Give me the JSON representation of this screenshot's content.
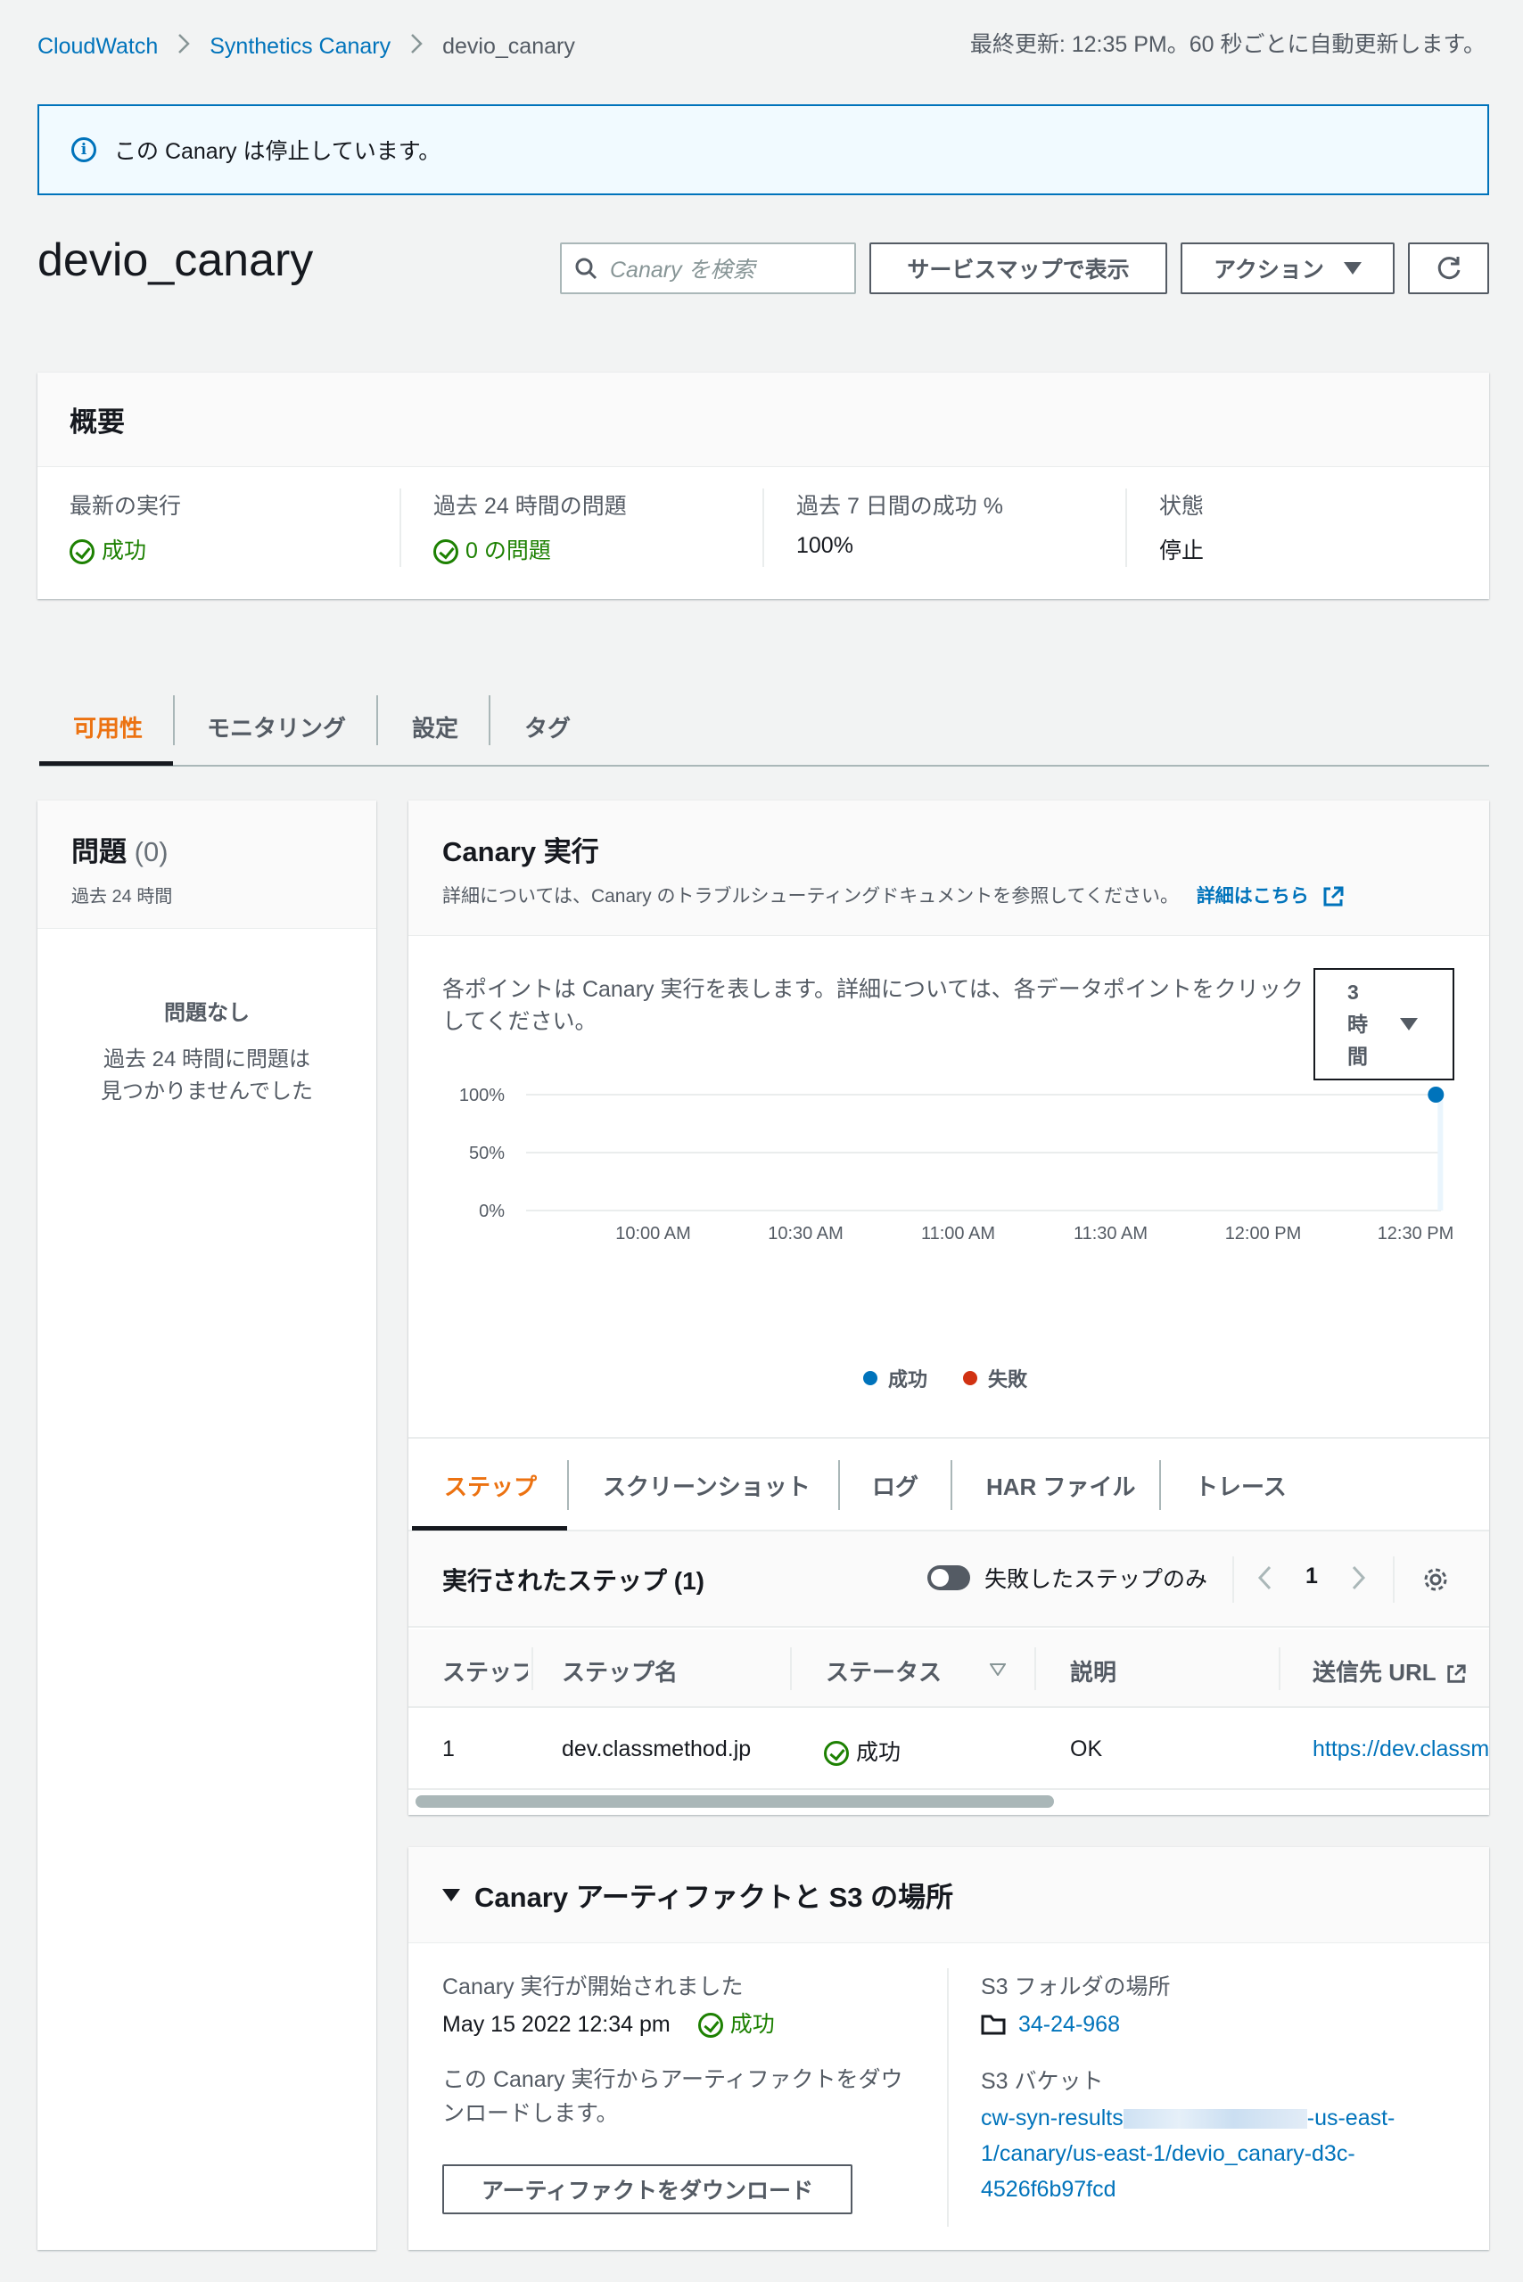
{
  "breadcrumb": {
    "item1": "CloudWatch",
    "item2": "Synthetics Canary",
    "current": "devio_canary"
  },
  "last_updated": "最終更新: 12:35 PM。60 秒ごとに自動更新します。",
  "banner": {
    "text": "この Canary は停止しています。"
  },
  "page_title": "devio_canary",
  "search": {
    "placeholder": "Canary を検索"
  },
  "header_buttons": {
    "service_map": "サービスマップで表示",
    "actions": "アクション"
  },
  "overview": {
    "title": "概要",
    "latest_run_label": "最新の実行",
    "latest_run_value": "成功",
    "issues_label": "過去 24 時間の問題",
    "issues_value": "0 の問題",
    "success_label": "過去 7 日間の成功 %",
    "success_value": "100%",
    "state_label": "状態",
    "state_value": "停止"
  },
  "tabs": [
    "可用性",
    "モニタリング",
    "設定",
    "タグ"
  ],
  "issues_panel": {
    "title": "問題",
    "count": "(0)",
    "subtitle": "過去 24 時間",
    "empty_title": "問題なし",
    "empty_line1": "過去 24 時間に問題は",
    "empty_line2": "見つかりませんでした"
  },
  "runs_panel": {
    "title": "Canary 実行",
    "description": "詳細については、Canary のトラブルシューティングドキュメントを参照してください。",
    "learn_more": "詳細はこちら",
    "hint_line1": "各ポイントは Canary 実行を表します。詳細については、各データポイントをクリック",
    "hint_line2": "してください。",
    "range_select": [
      "3",
      "時",
      "間"
    ]
  },
  "chart_data": {
    "type": "scatter",
    "x_ticks": [
      "10:00 AM",
      "10:30 AM",
      "11:00 AM",
      "11:30 AM",
      "12:00 PM",
      "12:30 PM"
    ],
    "y_ticks": [
      "100%",
      "50%",
      "0%"
    ],
    "ylim": [
      0,
      100
    ],
    "x_range_minutes": [
      "9:35 AM",
      "12:35 PM"
    ],
    "series": [
      {
        "name": "成功",
        "color": "#0073bb",
        "points": [
          {
            "x": "12:34 PM",
            "y": 100
          }
        ]
      },
      {
        "name": "失敗",
        "color": "#d13212",
        "points": []
      }
    ]
  },
  "sub_tabs": [
    "ステップ",
    "スクリーンショット",
    "ログ",
    "HAR ファイル",
    "トレース"
  ],
  "steps": {
    "title": "実行されたステップ (1)",
    "toggle_label": "失敗したステップのみ",
    "page": "1",
    "columns": [
      "ステップ",
      "ステップ名",
      "ステータス",
      "説明",
      "送信先 URL"
    ],
    "rows": [
      {
        "step": "1",
        "name": "dev.classmethod.jp",
        "status": "成功",
        "description": "OK",
        "url": "https://dev.classm"
      }
    ]
  },
  "artifacts": {
    "title": "Canary アーティファクトと S3 の場所",
    "run_started_label": "Canary 実行が開始されました",
    "run_started_value": "May 15 2022 12:34 pm",
    "run_status": "成功",
    "download_text_line1": "この Canary 実行からアーティファクトをダウ",
    "download_text_line2": "ンロードします。",
    "download_button": "アーティファクトをダウンロード",
    "s3_folder_label": "S3 フォルダの場所",
    "s3_folder_value": "34-24-968",
    "s3_bucket_label": "S3 バケット",
    "s3_bucket_line1a": "cw-syn-results",
    "s3_bucket_line1b": "-us-east-",
    "s3_bucket_line2": "1/canary/us-east-1/devio_canary-d3c-",
    "s3_bucket_line3": "4526f6b97fcd"
  }
}
